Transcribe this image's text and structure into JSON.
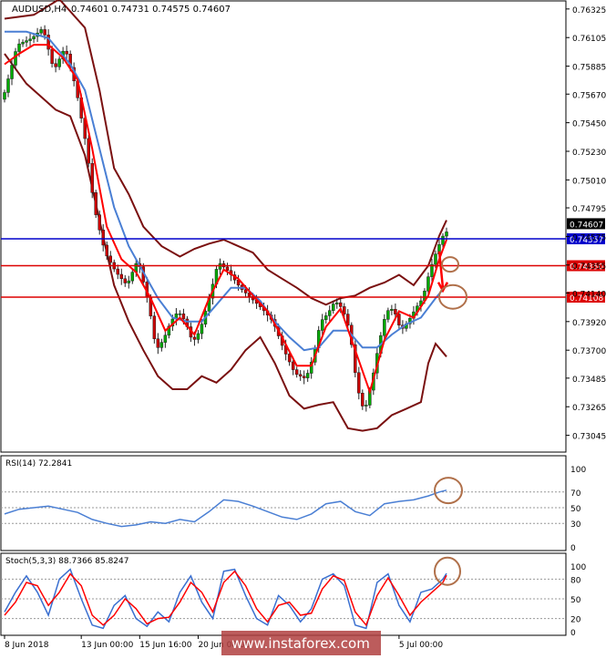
{
  "chart_data": {
    "type": "candlestick",
    "symbol_header": "AUDUSD,H4",
    "ohlc_header": "0.74601 0.74731 0.74575 0.74607",
    "price_axis_ticks": [
      "0.76325",
      "0.76105",
      "0.75885",
      "0.75670",
      "0.75450",
      "0.75230",
      "0.75010",
      "0.74795",
      "0.74575",
      "0.74355",
      "0.74140",
      "0.73920",
      "0.73700",
      "0.73485",
      "0.73265",
      "0.73045"
    ],
    "ylim": [
      0.7293,
      0.7638
    ],
    "x_ticks": [
      {
        "label": "8 Jun 2018",
        "bar": 0
      },
      {
        "label": "13 Jun 00:00",
        "bar": 21
      },
      {
        "label": "15 Jun 16:00",
        "bar": 37
      },
      {
        "label": "20 Jun 08:00",
        "bar": 53
      },
      {
        "label": "5 Jul 00:00",
        "bar": 108
      }
    ],
    "bar_count": 122,
    "price_path": [
      [
        0,
        0.7563
      ],
      [
        4,
        0.7605
      ],
      [
        8,
        0.761
      ],
      [
        11,
        0.7618
      ],
      [
        14,
        0.7585
      ],
      [
        17,
        0.7603
      ],
      [
        20,
        0.7572
      ],
      [
        23,
        0.7525
      ],
      [
        25,
        0.748
      ],
      [
        28,
        0.7445
      ],
      [
        31,
        0.743
      ],
      [
        34,
        0.742
      ],
      [
        37,
        0.744
      ],
      [
        40,
        0.7405
      ],
      [
        42,
        0.737
      ],
      [
        44,
        0.7378
      ],
      [
        46,
        0.7392
      ],
      [
        48,
        0.74
      ],
      [
        50,
        0.7392
      ],
      [
        52,
        0.7376
      ],
      [
        54,
        0.7385
      ],
      [
        57,
        0.7415
      ],
      [
        59,
        0.7438
      ],
      [
        62,
        0.743
      ],
      [
        65,
        0.7418
      ],
      [
        68,
        0.741
      ],
      [
        71,
        0.7402
      ],
      [
        74,
        0.7392
      ],
      [
        77,
        0.737
      ],
      [
        80,
        0.7352
      ],
      [
        83,
        0.7348
      ],
      [
        85,
        0.7365
      ],
      [
        87,
        0.7392
      ],
      [
        89,
        0.7398
      ],
      [
        91,
        0.7408
      ],
      [
        93,
        0.7402
      ],
      [
        95,
        0.7385
      ],
      [
        97,
        0.7342
      ],
      [
        99,
        0.7322
      ],
      [
        101,
        0.7345
      ],
      [
        103,
        0.7375
      ],
      [
        105,
        0.74
      ],
      [
        107,
        0.7402
      ],
      [
        109,
        0.7385
      ],
      [
        111,
        0.7392
      ],
      [
        113,
        0.7402
      ],
      [
        115,
        0.741
      ],
      [
        117,
        0.7432
      ],
      [
        119,
        0.7448
      ],
      [
        121,
        0.7461
      ]
    ],
    "bollinger_upper": [
      [
        0,
        0.7625
      ],
      [
        8,
        0.7628
      ],
      [
        15,
        0.764
      ],
      [
        22,
        0.7618
      ],
      [
        26,
        0.757
      ],
      [
        30,
        0.751
      ],
      [
        34,
        0.749
      ],
      [
        38,
        0.7465
      ],
      [
        43,
        0.745
      ],
      [
        48,
        0.7442
      ],
      [
        52,
        0.7448
      ],
      [
        56,
        0.7452
      ],
      [
        60,
        0.7455
      ],
      [
        64,
        0.745
      ],
      [
        68,
        0.7445
      ],
      [
        72,
        0.7432
      ],
      [
        76,
        0.7425
      ],
      [
        80,
        0.7418
      ],
      [
        84,
        0.741
      ],
      [
        88,
        0.7405
      ],
      [
        92,
        0.741
      ],
      [
        96,
        0.7412
      ],
      [
        100,
        0.7418
      ],
      [
        104,
        0.7422
      ],
      [
        108,
        0.7428
      ],
      [
        112,
        0.742
      ],
      [
        116,
        0.7435
      ],
      [
        119,
        0.7458
      ],
      [
        121,
        0.747
      ]
    ],
    "bollinger_lower": [
      [
        0,
        0.7598
      ],
      [
        6,
        0.7575
      ],
      [
        10,
        0.7565
      ],
      [
        14,
        0.7555
      ],
      [
        18,
        0.755
      ],
      [
        22,
        0.752
      ],
      [
        26,
        0.747
      ],
      [
        30,
        0.742
      ],
      [
        34,
        0.7392
      ],
      [
        38,
        0.737
      ],
      [
        42,
        0.735
      ],
      [
        46,
        0.734
      ],
      [
        50,
        0.734
      ],
      [
        54,
        0.735
      ],
      [
        58,
        0.7345
      ],
      [
        62,
        0.7355
      ],
      [
        66,
        0.737
      ],
      [
        70,
        0.738
      ],
      [
        74,
        0.736
      ],
      [
        78,
        0.7335
      ],
      [
        82,
        0.7325
      ],
      [
        86,
        0.7328
      ],
      [
        90,
        0.733
      ],
      [
        94,
        0.731
      ],
      [
        98,
        0.7308
      ],
      [
        102,
        0.731
      ],
      [
        106,
        0.732
      ],
      [
        110,
        0.7325
      ],
      [
        114,
        0.733
      ],
      [
        116,
        0.736
      ],
      [
        118,
        0.7375
      ],
      [
        121,
        0.7365
      ]
    ],
    "ma_fast_red": [
      [
        0,
        0.759
      ],
      [
        4,
        0.7598
      ],
      [
        8,
        0.7605
      ],
      [
        12,
        0.7605
      ],
      [
        16,
        0.7595
      ],
      [
        20,
        0.7578
      ],
      [
        24,
        0.7525
      ],
      [
        28,
        0.7465
      ],
      [
        32,
        0.744
      ],
      [
        36,
        0.743
      ],
      [
        40,
        0.741
      ],
      [
        44,
        0.7385
      ],
      [
        48,
        0.7395
      ],
      [
        52,
        0.7382
      ],
      [
        56,
        0.741
      ],
      [
        60,
        0.7432
      ],
      [
        64,
        0.7425
      ],
      [
        68,
        0.7412
      ],
      [
        72,
        0.74
      ],
      [
        76,
        0.738
      ],
      [
        80,
        0.7358
      ],
      [
        84,
        0.7358
      ],
      [
        88,
        0.7388
      ],
      [
        92,
        0.7402
      ],
      [
        96,
        0.737
      ],
      [
        100,
        0.7338
      ],
      [
        104,
        0.7378
      ],
      [
        108,
        0.74
      ],
      [
        112,
        0.7395
      ],
      [
        116,
        0.7412
      ],
      [
        119,
        0.744
      ],
      [
        121,
        0.7455
      ]
    ],
    "ma_slow_blue": [
      [
        0,
        0.7615
      ],
      [
        6,
        0.7615
      ],
      [
        12,
        0.761
      ],
      [
        18,
        0.759
      ],
      [
        22,
        0.757
      ],
      [
        26,
        0.7525
      ],
      [
        30,
        0.748
      ],
      [
        34,
        0.745
      ],
      [
        38,
        0.743
      ],
      [
        42,
        0.741
      ],
      [
        46,
        0.7395
      ],
      [
        50,
        0.7392
      ],
      [
        54,
        0.7392
      ],
      [
        58,
        0.7405
      ],
      [
        62,
        0.7418
      ],
      [
        66,
        0.7418
      ],
      [
        70,
        0.7408
      ],
      [
        74,
        0.7392
      ],
      [
        78,
        0.738
      ],
      [
        82,
        0.737
      ],
      [
        86,
        0.7372
      ],
      [
        90,
        0.7385
      ],
      [
        94,
        0.7385
      ],
      [
        98,
        0.7372
      ],
      [
        102,
        0.7372
      ],
      [
        106,
        0.7382
      ],
      [
        110,
        0.739
      ],
      [
        114,
        0.7395
      ],
      [
        118,
        0.741
      ],
      [
        121,
        0.742
      ]
    ],
    "levels": [
      {
        "label": "0.74557",
        "value": 0.74557,
        "color": "#0000cc"
      },
      {
        "label": "0.74350",
        "value": 0.7435,
        "color": "#dd0000"
      },
      {
        "label": "0.74108",
        "value": 0.74108,
        "color": "#dd0000"
      }
    ],
    "rsi": {
      "label": "RSI(14) 72.2841",
      "ticks": [
        "100",
        "70",
        "50",
        "30",
        "0"
      ],
      "levels": [
        70,
        50,
        30
      ],
      "values": [
        [
          0,
          42
        ],
        [
          4,
          48
        ],
        [
          8,
          50
        ],
        [
          12,
          52
        ],
        [
          16,
          48
        ],
        [
          20,
          44
        ],
        [
          24,
          35
        ],
        [
          28,
          30
        ],
        [
          32,
          26
        ],
        [
          36,
          28
        ],
        [
          40,
          32
        ],
        [
          44,
          30
        ],
        [
          48,
          35
        ],
        [
          52,
          32
        ],
        [
          56,
          45
        ],
        [
          60,
          60
        ],
        [
          64,
          58
        ],
        [
          68,
          52
        ],
        [
          72,
          45
        ],
        [
          76,
          38
        ],
        [
          80,
          35
        ],
        [
          84,
          42
        ],
        [
          88,
          55
        ],
        [
          92,
          58
        ],
        [
          96,
          45
        ],
        [
          100,
          40
        ],
        [
          104,
          55
        ],
        [
          108,
          58
        ],
        [
          112,
          60
        ],
        [
          116,
          65
        ],
        [
          119,
          70
        ],
        [
          121,
          72.28
        ]
      ]
    },
    "stoch": {
      "label": "Stoch(5,3,3) 88.7366 85.8247",
      "ticks": [
        "100",
        "80",
        "50",
        "20",
        "0"
      ],
      "levels": [
        80,
        50,
        20
      ],
      "main": [
        [
          0,
          30
        ],
        [
          3,
          60
        ],
        [
          6,
          85
        ],
        [
          9,
          60
        ],
        [
          12,
          25
        ],
        [
          15,
          80
        ],
        [
          18,
          95
        ],
        [
          21,
          50
        ],
        [
          24,
          10
        ],
        [
          27,
          5
        ],
        [
          30,
          40
        ],
        [
          33,
          55
        ],
        [
          36,
          20
        ],
        [
          39,
          8
        ],
        [
          42,
          30
        ],
        [
          45,
          15
        ],
        [
          48,
          60
        ],
        [
          51,
          85
        ],
        [
          54,
          45
        ],
        [
          57,
          20
        ],
        [
          60,
          92
        ],
        [
          63,
          95
        ],
        [
          66,
          55
        ],
        [
          69,
          20
        ],
        [
          72,
          10
        ],
        [
          75,
          55
        ],
        [
          78,
          40
        ],
        [
          81,
          15
        ],
        [
          84,
          35
        ],
        [
          87,
          80
        ],
        [
          90,
          88
        ],
        [
          93,
          70
        ],
        [
          96,
          10
        ],
        [
          99,
          5
        ],
        [
          102,
          75
        ],
        [
          105,
          88
        ],
        [
          108,
          40
        ],
        [
          111,
          15
        ],
        [
          114,
          60
        ],
        [
          117,
          65
        ],
        [
          120,
          80
        ],
        [
          121,
          88.74
        ]
      ],
      "signal": [
        [
          0,
          25
        ],
        [
          3,
          45
        ],
        [
          6,
          75
        ],
        [
          9,
          70
        ],
        [
          12,
          40
        ],
        [
          15,
          60
        ],
        [
          18,
          88
        ],
        [
          21,
          70
        ],
        [
          24,
          25
        ],
        [
          27,
          10
        ],
        [
          30,
          25
        ],
        [
          33,
          50
        ],
        [
          36,
          35
        ],
        [
          39,
          12
        ],
        [
          42,
          20
        ],
        [
          45,
          22
        ],
        [
          48,
          45
        ],
        [
          51,
          75
        ],
        [
          54,
          60
        ],
        [
          57,
          30
        ],
        [
          60,
          75
        ],
        [
          63,
          92
        ],
        [
          66,
          70
        ],
        [
          69,
          35
        ],
        [
          72,
          15
        ],
        [
          75,
          40
        ],
        [
          78,
          45
        ],
        [
          81,
          25
        ],
        [
          84,
          28
        ],
        [
          87,
          65
        ],
        [
          90,
          85
        ],
        [
          93,
          78
        ],
        [
          96,
          30
        ],
        [
          99,
          10
        ],
        [
          102,
          55
        ],
        [
          105,
          82
        ],
        [
          108,
          55
        ],
        [
          111,
          25
        ],
        [
          114,
          45
        ],
        [
          117,
          60
        ],
        [
          120,
          75
        ],
        [
          121,
          85.82
        ]
      ]
    },
    "annotations": {
      "down_arrow": [
        120,
        0.7446,
        0.7418
      ],
      "circles": [
        "price-level-0.7435",
        "price-level-0.7411",
        "rsi-peak",
        "stoch-peak"
      ]
    },
    "watermark": "www.instaforex.com",
    "colors": {
      "bull": "#00aa00",
      "bear": "#cc0000",
      "bollinger": "#7a1010",
      "ma_fast": "#ff0000",
      "ma_slow": "#4a7fd4",
      "rsi_line": "#4a7fd4",
      "stoch_main": "#3a6fd0",
      "stoch_signal": "#ff0000",
      "highlight": "#b0704a",
      "last_price_tag": "#000000",
      "watermark_bg": "#b04040"
    }
  }
}
